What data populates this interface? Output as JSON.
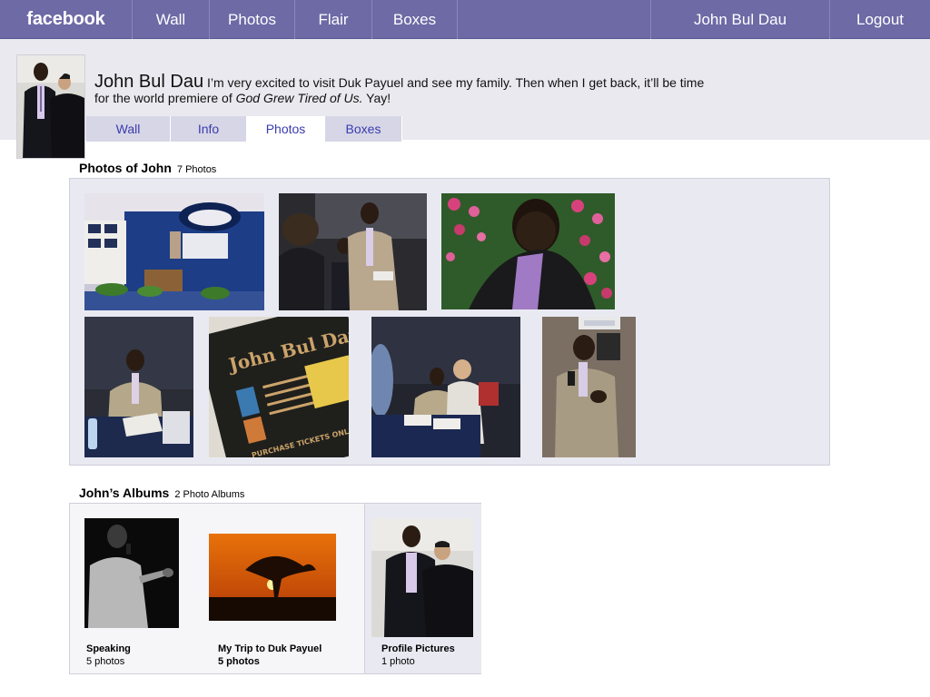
{
  "topnav": {
    "brand": "facebook",
    "items": [
      "Wall",
      "Photos",
      "Flair",
      "Boxes"
    ],
    "user": "John Bul Dau",
    "logout": "Logout"
  },
  "profile": {
    "name": "John Bul Dau",
    "status_line1": "I’m very excited to visit Duk Payuel and see my family. Then when I get back, it’ll be time",
    "status_line2_pre": "for the world premiere of ",
    "status_line2_em": "God Grew Tired of Us.",
    "status_line2_post": " Yay!",
    "tabs": [
      "Wall",
      "Info",
      "Photos",
      "Boxes"
    ],
    "active_tab": "Photos"
  },
  "photos_section": {
    "title": "Photos of John",
    "count": "7 Photos"
  },
  "albums_section": {
    "title": "John’s Albums",
    "count": "2 Photo Albums",
    "albums": [
      {
        "title": "Speaking",
        "count": "5 photos"
      },
      {
        "title": "My Trip to Duk Payuel",
        "count": "5 photos"
      },
      {
        "title": "Profile Pictures",
        "count": "1 photo"
      }
    ]
  },
  "poster": {
    "title": "John Bul Dau",
    "line": "PURCHASE TICKETS ONLINE"
  },
  "colors": {
    "nav": "#6d6aa6",
    "band": "#e9e9ef",
    "link": "#3b3bb0"
  }
}
